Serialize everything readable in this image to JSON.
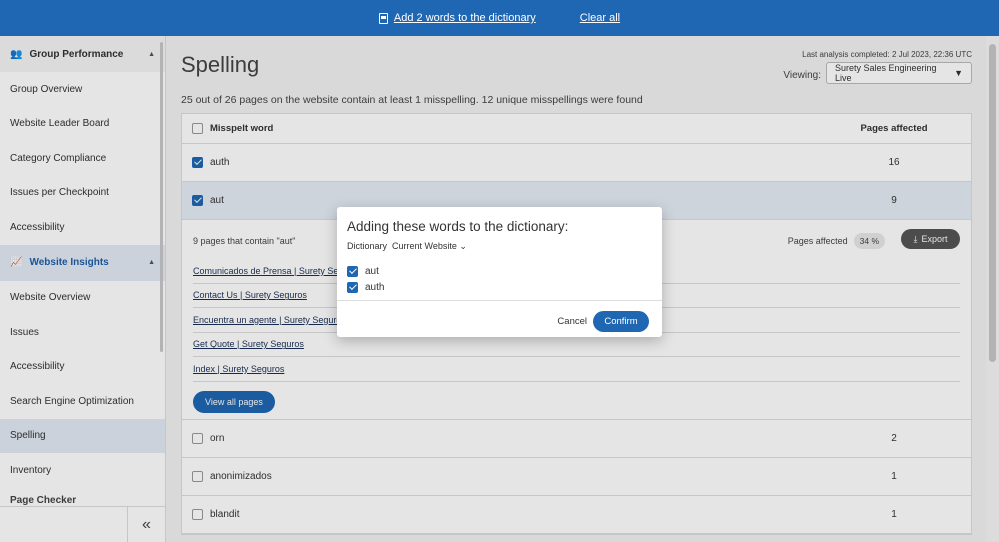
{
  "topbar": {
    "add_label": "Add 2 words to the dictionary",
    "clear_label": "Clear all"
  },
  "sidebar": {
    "group_section": "Group Performance",
    "group_items": [
      "Group Overview",
      "Website Leader Board",
      "Category Compliance",
      "Issues per Checkpoint",
      "Accessibility"
    ],
    "insights_section": "Website Insights",
    "insights_items": [
      "Website Overview",
      "Issues",
      "Accessibility",
      "Search Engine Optimization",
      "Spelling",
      "Inventory"
    ],
    "active_item": "Spelling",
    "cut_item": "Page Checker"
  },
  "main": {
    "title": "Spelling",
    "last_analysis": "Last analysis completed: 2 Jul 2023, 22:36 UTC",
    "viewing_label": "Viewing:",
    "viewing_value": "Surety Sales Engineering Live",
    "summary": "25 out of 26 pages on the website contain at least 1 misspelling. 12 unique misspellings were found"
  },
  "table": {
    "col_word": "Misspelt word",
    "col_pages": "Pages affected",
    "rows_top": [
      {
        "word": "auth",
        "count": "16",
        "checked": true
      },
      {
        "word": "aut",
        "count": "9",
        "checked": true
      }
    ],
    "expanded": {
      "title": "9 pages that contain \"aut\"",
      "pages_affected_label": "Pages affected",
      "pct": "34 %",
      "export_label": "Export",
      "links": [
        "Comunicados de Prensa | Surety Seguros",
        "Contact Us | Surety Seguros",
        "Encuentra un agente | Surety Seguros",
        "Get Quote | Surety Seguros",
        "Index | Surety Seguros"
      ],
      "view_all_label": "View all pages"
    },
    "rows_bottom": [
      {
        "word": "orn",
        "count": "2",
        "checked": false
      },
      {
        "word": "anonimizados",
        "count": "1",
        "checked": false
      },
      {
        "word": "blandit",
        "count": "1",
        "checked": false
      }
    ]
  },
  "modal": {
    "title": "Adding these words to the dictionary:",
    "dict_label": "Dictionary",
    "dict_value": "Current Website",
    "words": [
      "aut",
      "auth"
    ],
    "cancel_label": "Cancel",
    "confirm_label": "Confirm"
  },
  "colors": {
    "accent": "#1f66b3",
    "selected_row": "#e6ecf5"
  }
}
